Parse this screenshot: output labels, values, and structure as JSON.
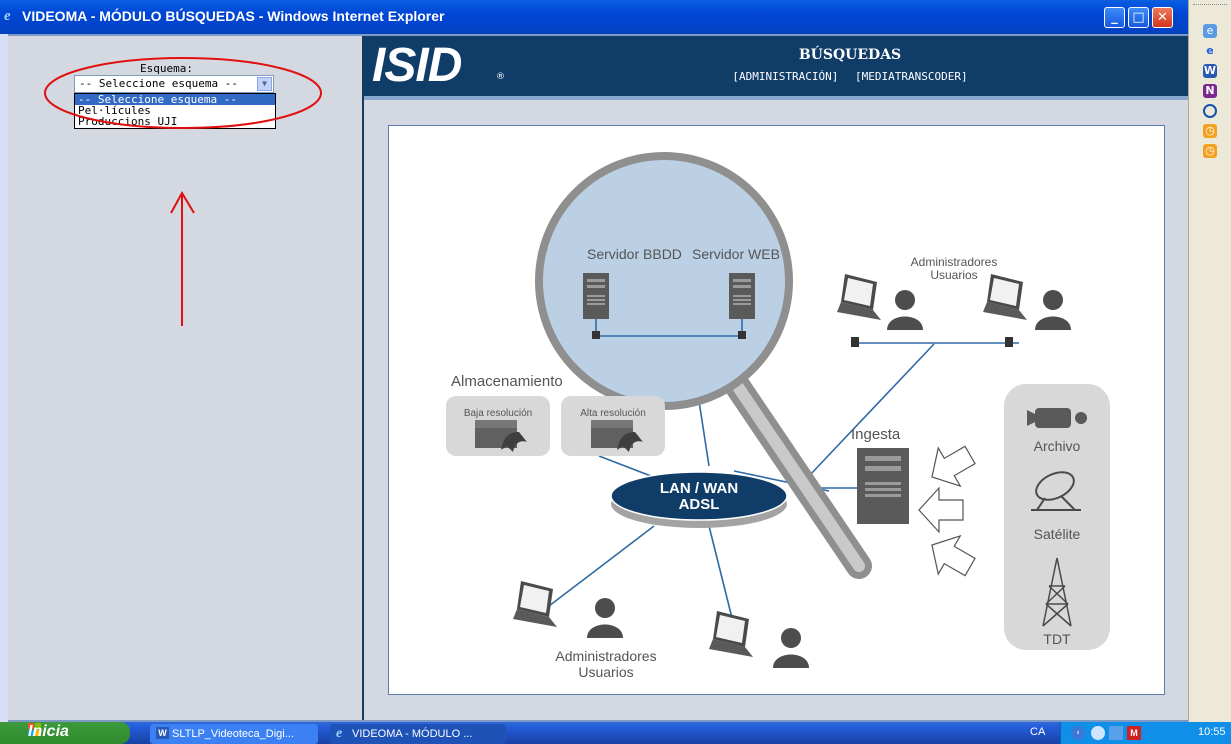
{
  "window": {
    "title": "VIDEOMA - MÓDULO BÚSQUEDAS - Windows Internet Explorer",
    "minimize": "_",
    "maximize": "□",
    "close": "✕"
  },
  "header": {
    "logo": "ISID",
    "logo_mark": "®",
    "title": "BÚSQUEDAS",
    "links": [
      "[ADMINISTRACIÓN]",
      "[MEDIATRANSCODER]"
    ]
  },
  "schema": {
    "label": "Esquema:",
    "selected": "-- Seleccione esquema --",
    "options": [
      "-- Seleccione esquema --",
      "Pel·lícules",
      "Produccions UJI"
    ]
  },
  "diagram": {
    "servers": [
      "Servidor BBDD",
      "Servidor WEB"
    ],
    "admins_top": [
      "Administradores",
      "Usuarios"
    ],
    "storage_title": "Almacenamiento",
    "storage_low": "Baja resolución",
    "storage_high": "Alta resolución",
    "network": [
      "LAN / WAN",
      "ADSL"
    ],
    "ingest": "Ingesta",
    "sources": [
      "Archivo",
      "Satélite",
      "TDT"
    ],
    "admins_bottom": [
      "Administradores",
      "Usuarios"
    ],
    "colors": {
      "lens": "#bcd0e5",
      "line": "#2f6aa5",
      "panel": "#d8d8d8",
      "dark": "#555555"
    }
  },
  "taskbar": {
    "start": "Inicia",
    "tasks": [
      "SLTLP_Videoteca_Digi...",
      "VIDEOMA - MÓDULO ..."
    ],
    "lang": "CA",
    "clock": "10:55"
  },
  "sidebar_icons": [
    "ie-icon",
    "ie-icon",
    "word-icon",
    "onenote-icon",
    "media-icon",
    "clock-icon",
    "clock-icon"
  ]
}
